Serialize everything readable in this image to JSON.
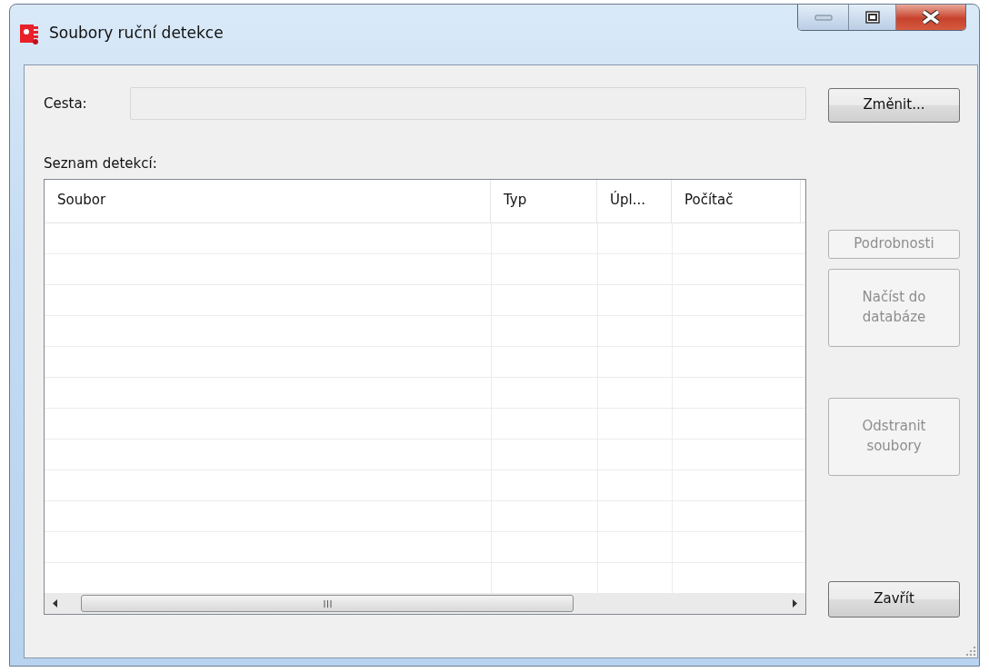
{
  "window": {
    "title": "Soubory ruční detekce"
  },
  "path": {
    "label": "Cesta:",
    "disabled": true
  },
  "change_button": {
    "label": "Změnit...",
    "disabled": false
  },
  "list": {
    "label": "Seznam detekcí:",
    "columns": [
      "Soubor",
      "Typ",
      "Úpl...",
      "Počítač"
    ]
  },
  "side_buttons": [
    {
      "label": "Podrobnosti",
      "disabled": true
    },
    {
      "label": "Načíst do databáze",
      "disabled": true
    },
    {
      "label": "Odstranit soubory",
      "disabled": true
    }
  ],
  "close_button": {
    "label": "Zavřít",
    "disabled": false
  }
}
